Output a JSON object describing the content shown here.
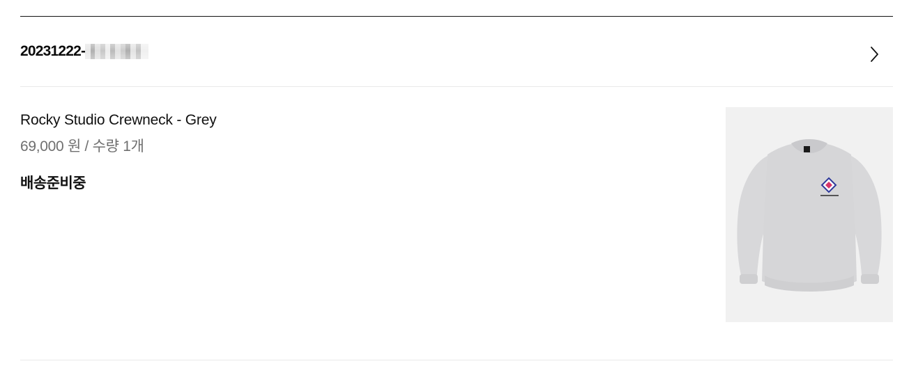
{
  "order": {
    "number_prefix": "20231222-",
    "number_masked": "(masked)",
    "detail_icon": "chevron-right-icon"
  },
  "item": {
    "name": "Rocky Studio Crewneck - Grey",
    "price": "69,000 원",
    "separator": "/",
    "quantity": "수량 1개",
    "status": "배송준비중",
    "image_alt": "Rocky Studio Crewneck - Grey"
  },
  "colors": {
    "text_primary": "#111111",
    "text_secondary": "#6f6f6f",
    "divider": "#e9e9e9",
    "image_bg": "#f1f1f1",
    "sweatshirt": "#d6d6d8"
  }
}
